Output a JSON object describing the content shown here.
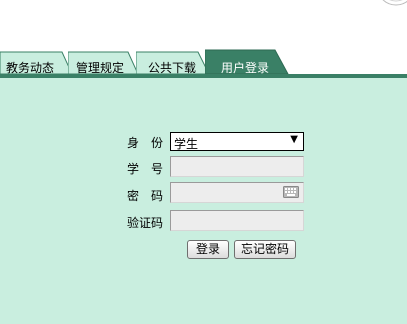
{
  "nav": {
    "tabs": [
      {
        "label": "教务动态",
        "active": false
      },
      {
        "label": "管理规定",
        "active": false
      },
      {
        "label": "公共下载",
        "active": false
      },
      {
        "label": "用户登录",
        "active": true
      }
    ]
  },
  "login": {
    "identity_label": "身　份",
    "identity_value": "学生",
    "student_id_label": "学　号",
    "student_id_value": "",
    "password_label": "密　码",
    "password_value": "",
    "captcha_label": "验证码",
    "captcha_value": "",
    "login_button": "登录",
    "forgot_button": "忘记密码"
  },
  "icons": {
    "keyboard": "keyboard-icon",
    "dropdown": "triangle-down-icon",
    "seal": "school-seal-icon"
  },
  "colors": {
    "active_tab": "#3a8066",
    "inactive_tab": "#c9eedf",
    "content_bg": "#c9eedf"
  }
}
